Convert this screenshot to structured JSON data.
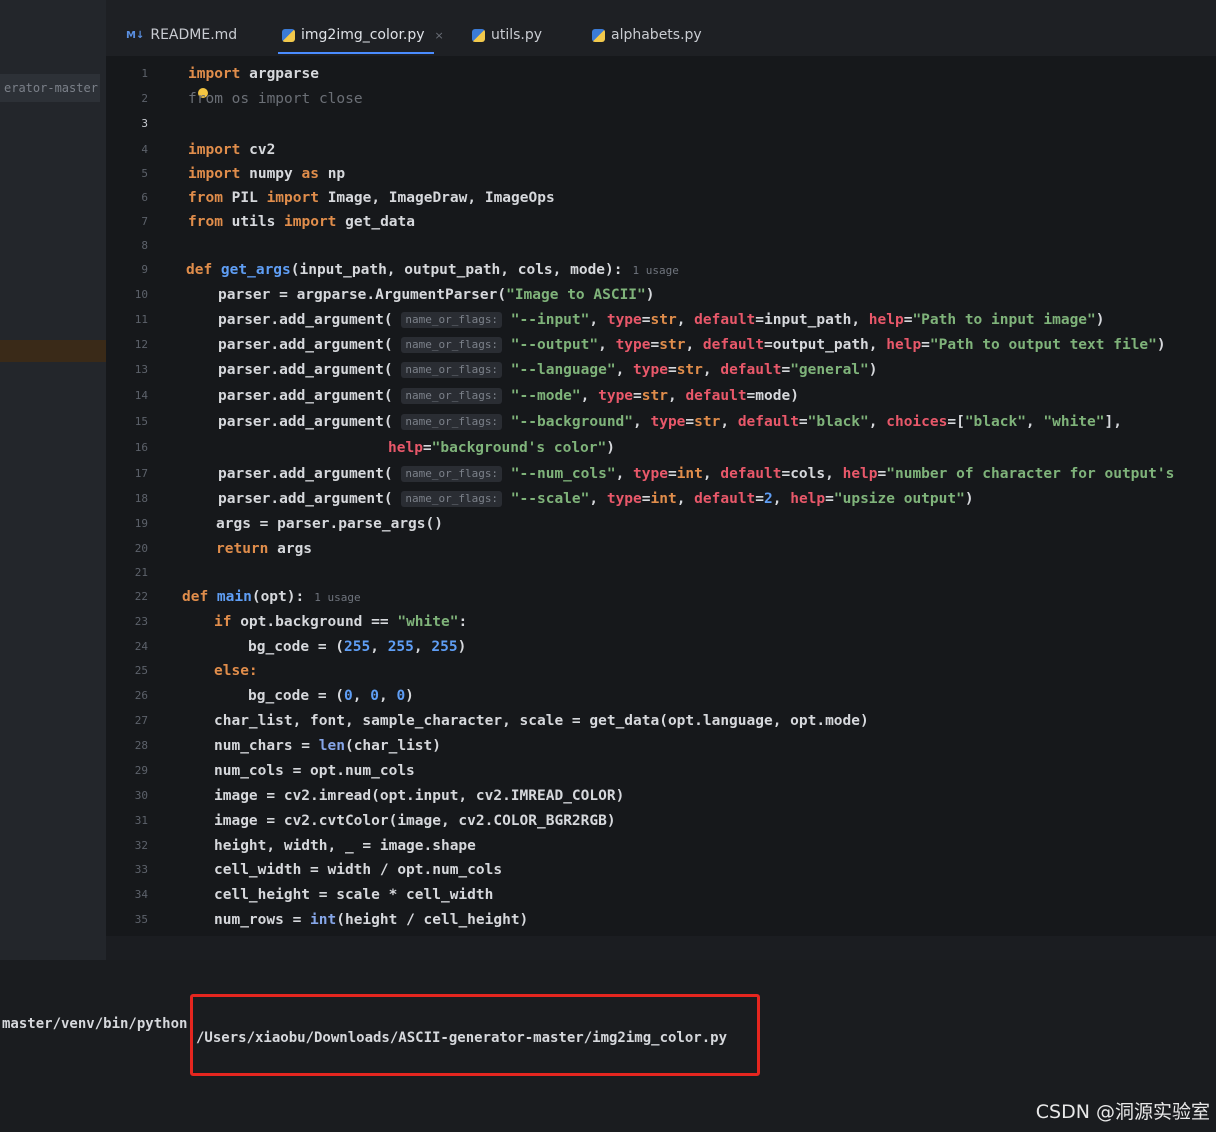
{
  "project_panel": {
    "label": "erator-master"
  },
  "tabs": [
    {
      "label": "README.md",
      "icon": "markdown-icon",
      "badge": "M↓"
    },
    {
      "label": "img2img_color.py",
      "icon": "python-icon",
      "active": true,
      "close": "×"
    },
    {
      "label": "utils.py",
      "icon": "python-icon"
    },
    {
      "label": "alphabets.py",
      "icon": "python-icon"
    }
  ],
  "code": {
    "hint_label": "name_or_flags:",
    "usage_label": "1 usage",
    "l1a": "import",
    "l1b": " argparse",
    "l2": "from os import close",
    "l4a": "import",
    "l4b": " cv2",
    "l5a": "import",
    "l5b": " numpy ",
    "l5c": "as",
    "l5d": " np",
    "l6a": "from",
    "l6b": " PIL ",
    "l6c": "import",
    "l6d": " Image, ImageDraw, ImageOps",
    "l7a": "from",
    "l7b": " utils ",
    "l7c": "import",
    "l7d": " get_data",
    "l9a": "def ",
    "l9b": "get_args",
    "l9c": "(input_path, output_path, cols, mode):",
    "l10a": "parser = argparse.ArgumentParser(",
    "l10b": "\"Image to ASCII\"",
    "l10c": ")",
    "pa": "parser.add_argument(",
    "l11s": "\"--input\"",
    "l11m": "input_path, ",
    "l11h": "\"Path to input image\"",
    "l12s": "\"--output\"",
    "l12m": "output_path, ",
    "l12h": "\"Path to output text file\"",
    "l13s": "\"--language\"",
    "l13d": "\"general\"",
    "l14s": "\"--mode\"",
    "l14m": "mode",
    "l15s": "\"--background\"",
    "l15d": "\"black\"",
    "l15c1": "\"black\"",
    "l15c2": "\"white\"",
    "l16h": "\"background's color\"",
    "l17s": "\"--num_cols\"",
    "l17m": "cols, ",
    "l17h": "\"number of character for output's",
    "l18s": "\"--scale\"",
    "l18n": "2",
    "l18h": "\"upsize output\"",
    "l19": "args = parser.parse_args()",
    "l20a": "return",
    "l20b": " args",
    "l22a": "def ",
    "l22b": "main",
    "l22c": "(opt):",
    "l23a": "if",
    "l23b": " opt.background == ",
    "l23c": "\"white\"",
    "l23d": ":",
    "l24a": "bg_code = (",
    "l24n1": "255",
    "l24n2": "255",
    "l24n3": "255",
    "l24z": ")",
    "l25": "else:",
    "l26a": "bg_code = (",
    "l26n": "0",
    "l26z": ")",
    "l27": "char_list, font, sample_character, scale = get_data(opt.language, opt.mode)",
    "l28a": "num_chars = ",
    "l28b": "len",
    "l28c": "(char_list)",
    "l29": "num_cols = opt.num_cols",
    "l30": "image = cv2.imread(opt.input, cv2.IMREAD_COLOR)",
    "l31": "image = cv2.cvtColor(image, cv2.COLOR_BGR2RGB)",
    "l32": "height, width, _ = image.shape",
    "l33": "cell_width = width / opt.num_cols",
    "l34": "cell_height = scale * cell_width",
    "l35a": "num_rows = ",
    "l35b": "int",
    "l35c": "(height / cell_height)"
  },
  "line_numbers": [
    "1",
    "2",
    "3",
    "4",
    "5",
    "6",
    "7",
    "8",
    "9",
    "10",
    "11",
    "12",
    "13",
    "14",
    "15",
    "16",
    "17",
    "18",
    "19",
    "20",
    "21",
    "22",
    "23",
    "24",
    "25",
    "26",
    "27",
    "28",
    "29",
    "30",
    "31",
    "32",
    "33",
    "34",
    "35"
  ],
  "terminal": {
    "python_path": "master/venv/bin/python",
    "script_path": "/Users/xiaobu/Downloads/ASCII-generator-master/img2img_color.py"
  },
  "watermark": "CSDN @洞源实验室",
  "colors": {
    "keyword": "#e08d4b",
    "function": "#5f9ef5",
    "string": "#7fb37a",
    "param": "#e8586a",
    "highlight_box": "#e5261f"
  }
}
